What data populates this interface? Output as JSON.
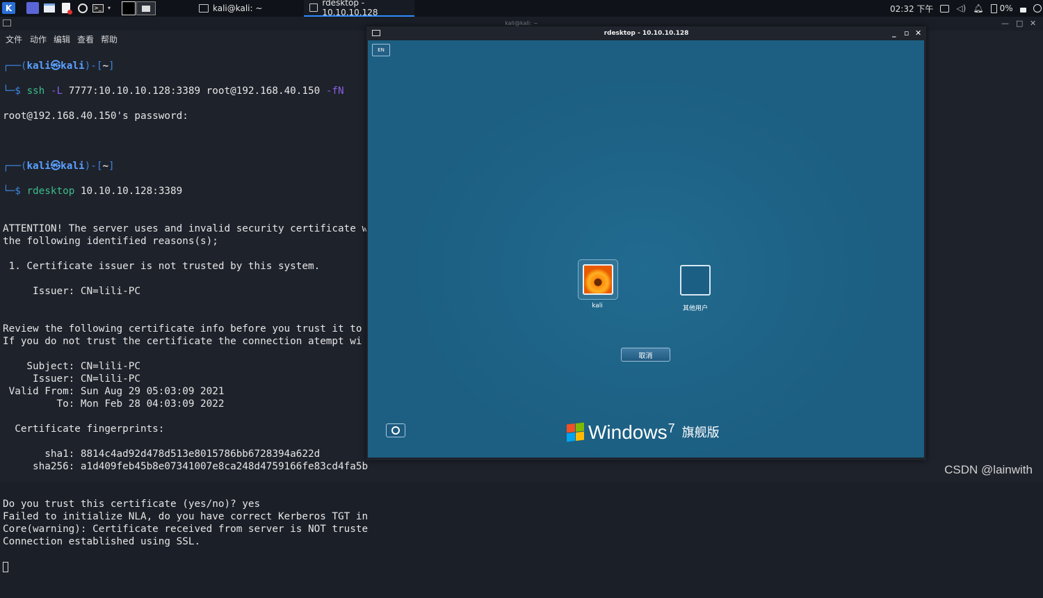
{
  "taskbar": {
    "tasks": [
      {
        "label": "kali@kali: ~"
      },
      {
        "label": "rdesktop - 10.10.10.128"
      }
    ],
    "clock": "02:32 下午",
    "battery": "0%"
  },
  "terminal": {
    "title": "kali@kali: ~",
    "menu": [
      "文件",
      "动作",
      "编辑",
      "查看",
      "帮助"
    ],
    "prompt_user": "kali",
    "prompt_symbol": "㉿",
    "prompt_host": "kali",
    "prompt_dir": "~",
    "cmd1_name": "ssh",
    "cmd1_flag1": "-L",
    "cmd1_args": "7777:10.10.10.128:3389 root@192.168.40.150",
    "cmd1_flag2": "-fN",
    "cmd2_name": "rdesktop",
    "cmd2_args": "10.10.10.128:3389",
    "output1": [
      "root@192.168.40.150's password:"
    ],
    "output2": [
      "",
      "ATTENTION! The server uses and invalid security certificate w",
      "the following identified reasons(s);",
      "",
      " 1. Certificate issuer is not trusted by this system.",
      "",
      "     Issuer: CN=lili-PC",
      "",
      "",
      "Review the following certificate info before you trust it to",
      "If you do not trust the certificate the connection atempt wi",
      "",
      "    Subject: CN=lili-PC",
      "     Issuer: CN=lili-PC",
      " Valid From: Sun Aug 29 05:03:09 2021",
      "         To: Mon Feb 28 04:03:09 2022",
      "",
      "  Certificate fingerprints:",
      "",
      "       sha1: 8814c4ad92d478d513e8015786bb6728394a622d",
      "     sha256: a1d409feb45b8e07341007e8ca248d4759166fe83cd4fa5b",
      "",
      "",
      "Do you trust this certificate (yes/no)? yes",
      "Failed to initialize NLA, do you have correct Kerberos TGT in",
      "Core(warning): Certificate received from server is NOT truste",
      "Connection established using SSL."
    ]
  },
  "rdp": {
    "title": "rdesktop - 10.10.10.128",
    "lang": "EN",
    "users": [
      {
        "name": "kali"
      },
      {
        "name": "其他用户"
      }
    ],
    "cancel": "取消",
    "brand": "Windows",
    "version": "7",
    "edition": "旗舰版"
  },
  "watermark": "CSDN @lainwith"
}
